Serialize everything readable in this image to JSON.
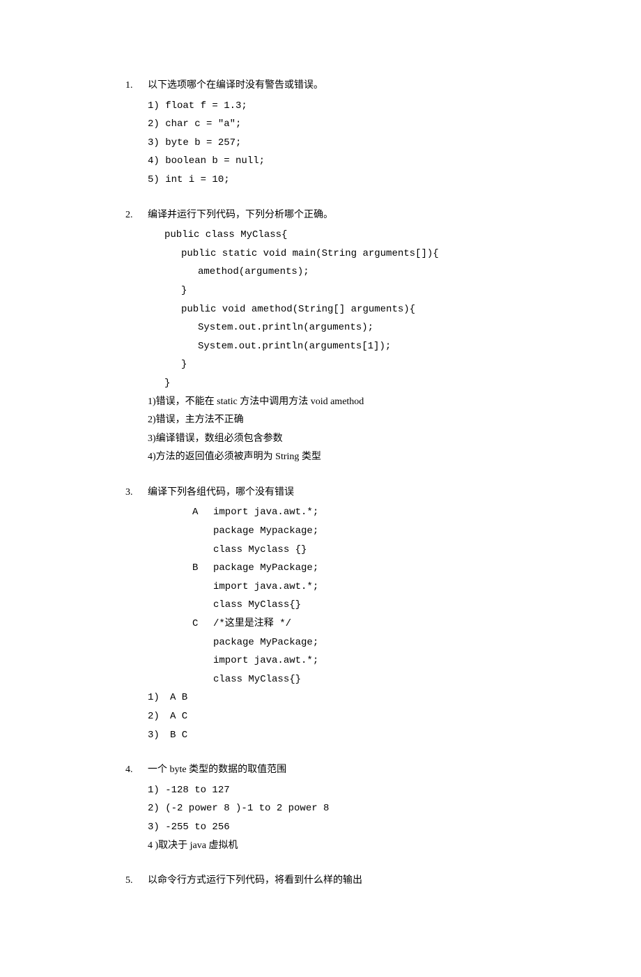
{
  "q1": {
    "num": "1.",
    "text": "以下选项哪个在编译时没有警告或错误。",
    "opts": [
      "1) float f = 1.3;",
      "2) char c = \"a\";",
      "3) byte b = 257;",
      "4) boolean b = null;",
      "5) int i = 10;"
    ]
  },
  "q2": {
    "num": "2.",
    "text": "编译并运行下列代码，下列分析哪个正确。",
    "code": [
      "public class MyClass{",
      "   public static void main(String arguments[]){",
      "       amethod(arguments);",
      "   }",
      "   public void amethod(String[] arguments){",
      "      System.out.println(arguments);",
      "      System.out.println(arguments[1]);",
      "   }",
      "  }"
    ],
    "ans": [
      "1)错误，不能在 static 方法中调用方法 void amethod",
      "2)错误，主方法不正确",
      "3)编译错误，数组必须包含参数",
      "4)方法的返回值必须被声明为 String 类型"
    ]
  },
  "q3": {
    "num": "3.",
    "text": "编译下列各组代码，哪个没有错误",
    "groups": [
      {
        "letter": "A",
        "lines": [
          "import java.awt.*;",
          "package Mypackage;",
          "class Myclass {}"
        ]
      },
      {
        "letter": "B",
        "lines": [
          "package MyPackage;",
          "import java.awt.*;",
          "class MyClass{}"
        ]
      },
      {
        "letter": "C",
        "lines": [
          "/*这里是注释 */",
          "package MyPackage;",
          "import java.awt.*;",
          "class MyClass{}"
        ]
      }
    ],
    "opts": [
      {
        "no": "1)",
        "val": "A B"
      },
      {
        "no": "2)",
        "val": "A C"
      },
      {
        "no": "3)",
        "val": "B C"
      }
    ]
  },
  "q4": {
    "num": "4.",
    "text": "一个 byte 类型的数据的取值范围",
    "opts": [
      "1) -128 to 127",
      "2) (-2 power 8 )-1 to 2 power 8",
      "3) -255 to 256",
      "4 )取决于 java 虚拟机"
    ]
  },
  "q5": {
    "num": "5.",
    "text": "以命令行方式运行下列代码，将看到什么样的输出"
  }
}
